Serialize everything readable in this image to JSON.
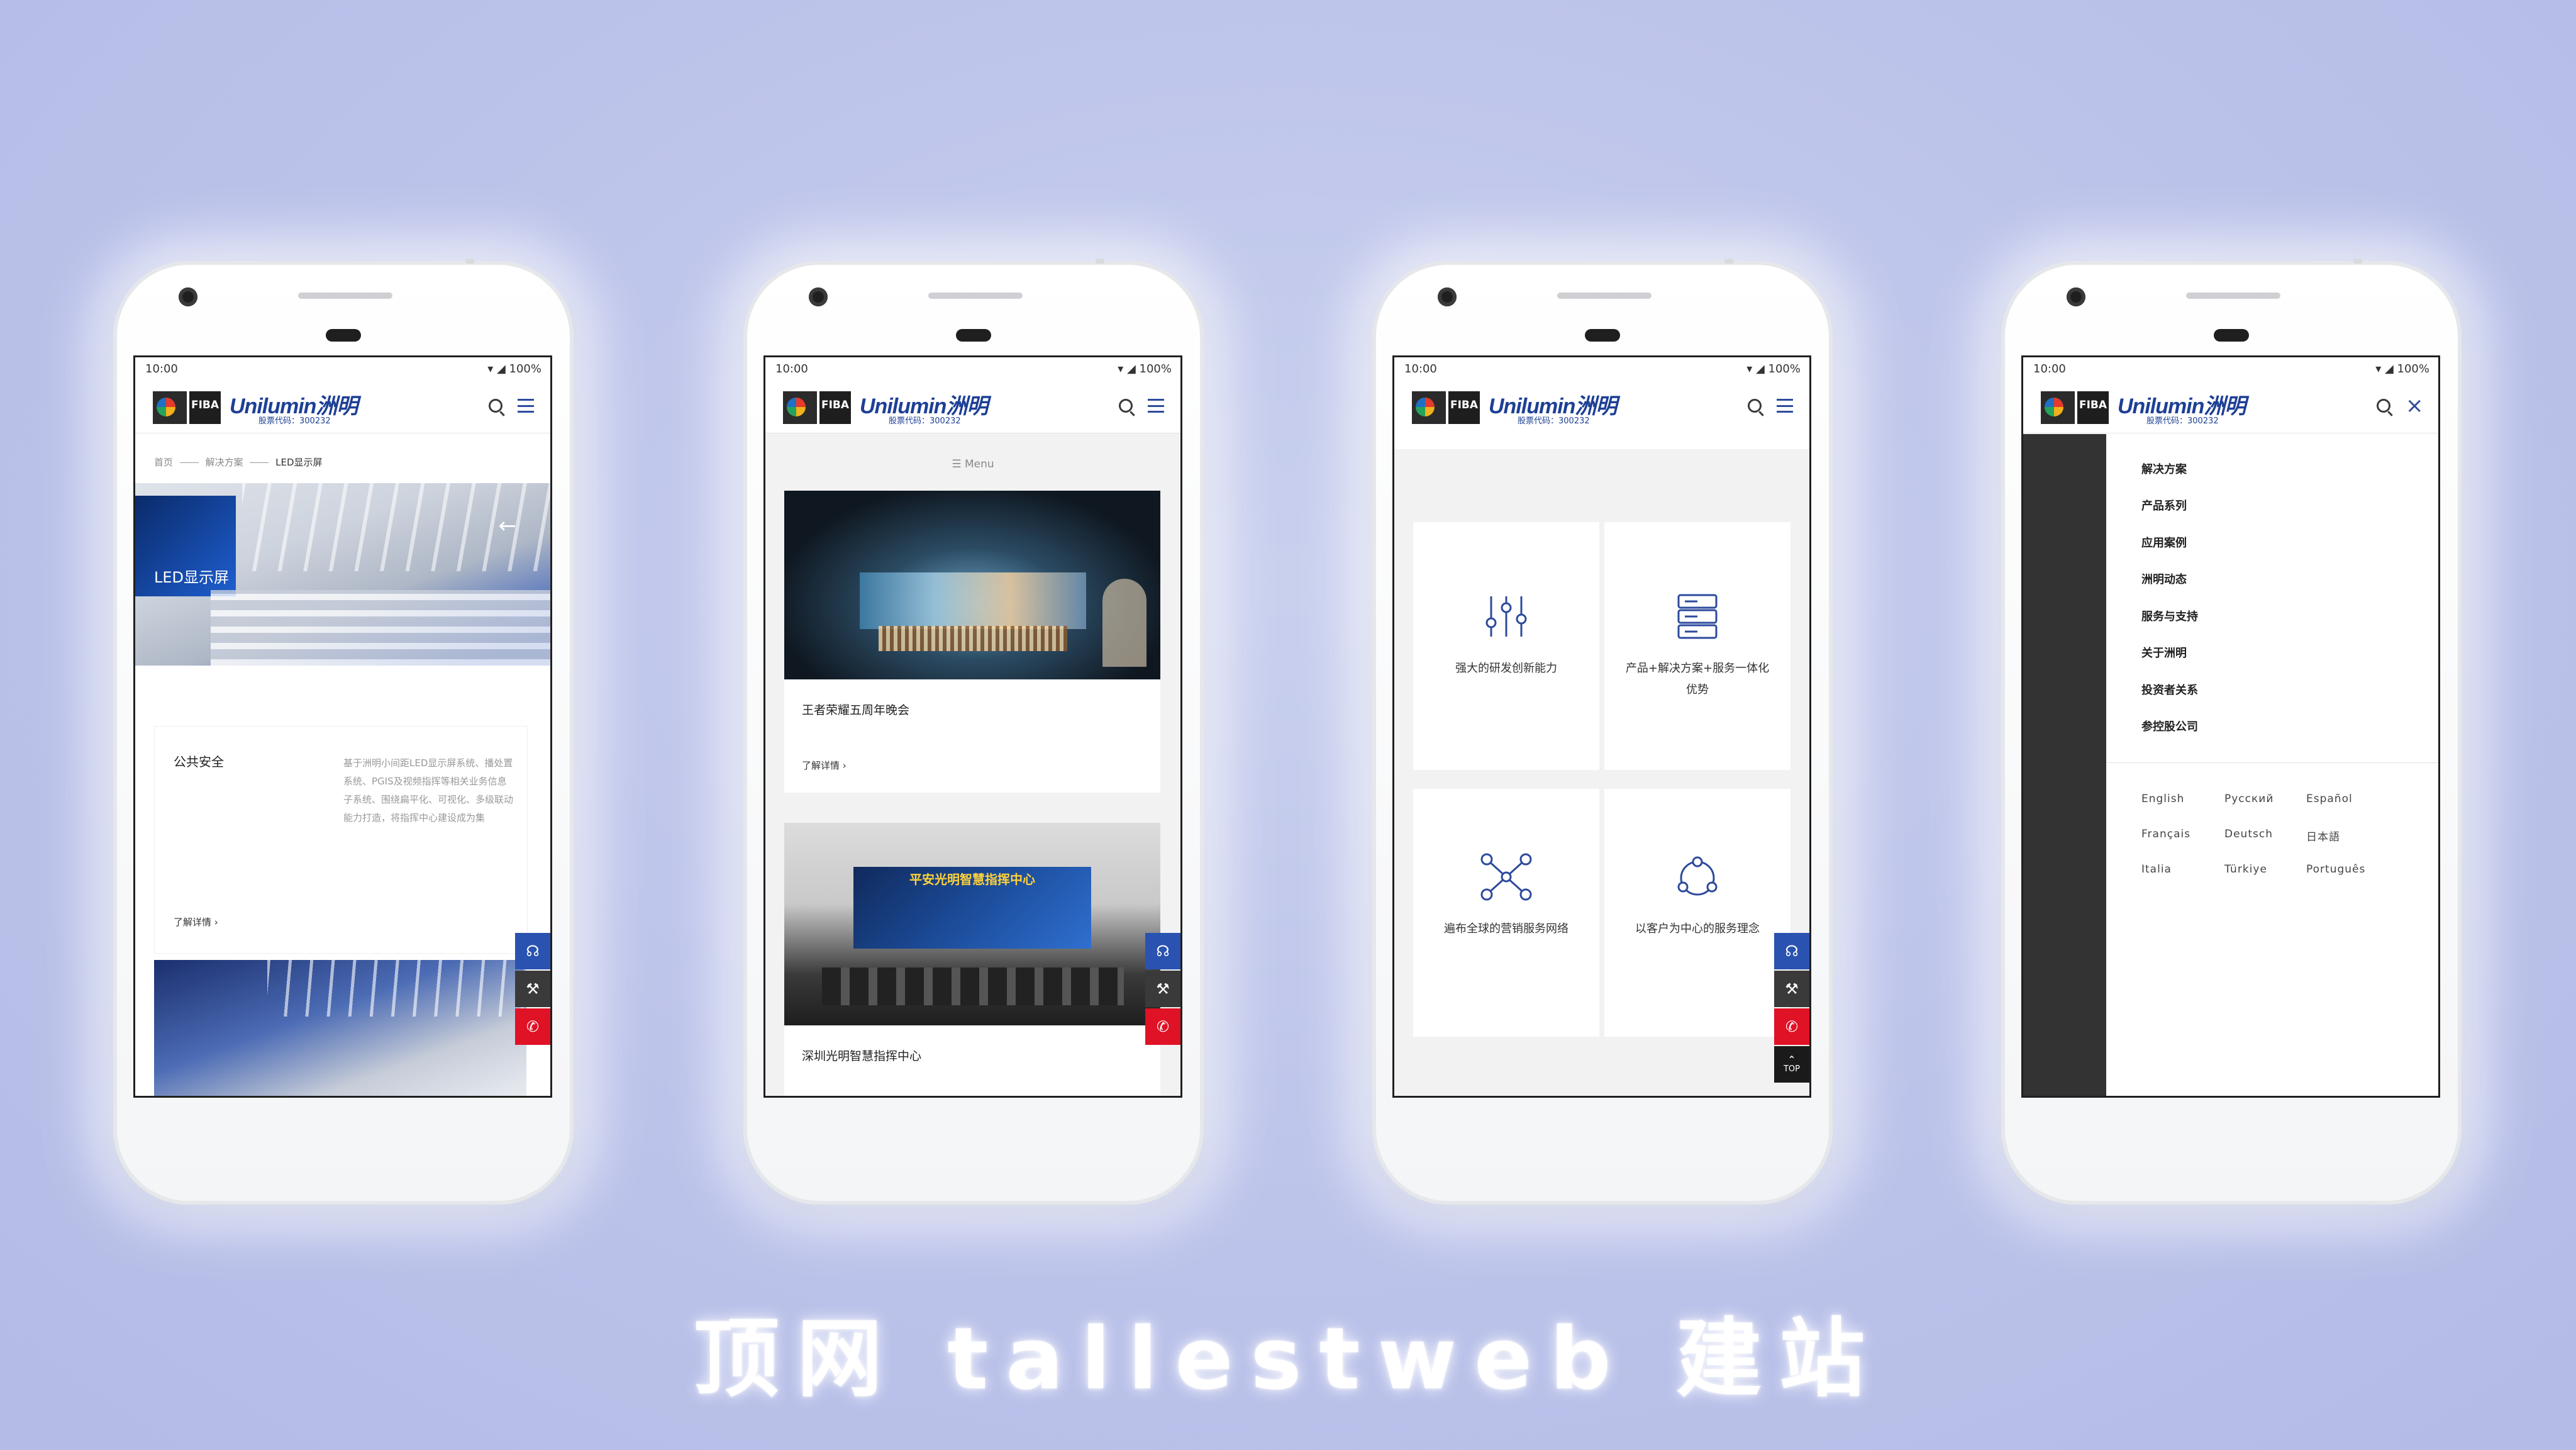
{
  "status": {
    "time": "10:00",
    "battery": "100%"
  },
  "header": {
    "fiba": "FIBA",
    "brand": "Unilumin洲明",
    "stock": "股票代码：300232"
  },
  "phone1": {
    "breadcrumb": [
      "首页",
      "解决方案",
      "LED显示屏"
    ],
    "hero_label": "LED显示屏",
    "card_title": "公共安全",
    "card_desc": "基于洲明小间距LED显示屏系统、播处置系统、PGIS及视频指挥等相关业务信息子系统、围绕扁平化、可视化、多级联动能力打造，将指挥中心建设成为集",
    "card_link": "了解详情"
  },
  "phone2": {
    "menu_label": "Menu",
    "case1_title": "王者荣耀五周年晚会",
    "case1_link": "了解详情",
    "case2_sign": "平安光明智慧指挥中心",
    "case2_title": "深圳光明智慧指挥中心"
  },
  "phone3": {
    "features": [
      {
        "label": "强大的研发创新能力",
        "icon": "sliders-icon"
      },
      {
        "label": "产品+解决方案+服务一体化优势",
        "icon": "server-icon"
      },
      {
        "label": "遍布全球的营销服务网络",
        "icon": "network-icon"
      },
      {
        "label": "以客户为中心的服务理念",
        "icon": "cycle-icon"
      }
    ],
    "top_label": "TOP"
  },
  "phone4": {
    "nav": [
      "解决方案",
      "产品系列",
      "应用案例",
      "洲明动态",
      "服务与支持",
      "关于洲明",
      "投资者关系",
      "参控股公司"
    ],
    "languages": [
      "English",
      "Русский",
      "Español",
      "Français",
      "Deutsch",
      "日本語",
      "Italia",
      "Türkiye",
      "Português"
    ]
  },
  "footer": {
    "text": "顶网 tallestweb 建站"
  },
  "colors": {
    "brand_blue": "#1d3f95",
    "float_blue": "#2a52b0",
    "float_red": "#e01226",
    "background": "#bcc3ea"
  }
}
